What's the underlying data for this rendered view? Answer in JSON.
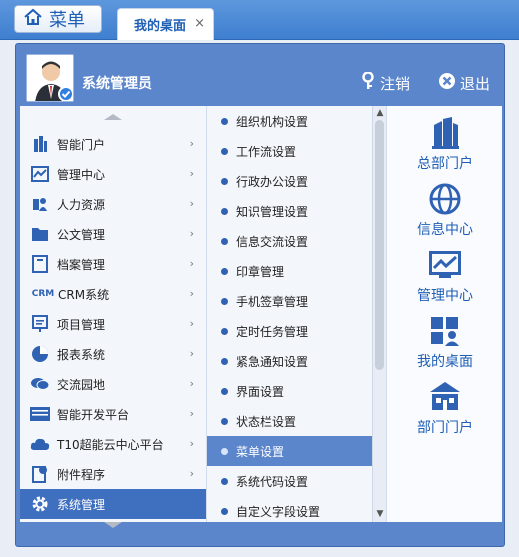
{
  "topbar": {
    "menu_label": "菜单",
    "tab_label": "我的桌面",
    "tab_close": "×"
  },
  "popup": {
    "username": "系统管理员",
    "logout_label": "注销",
    "exit_label": "退出",
    "level1": [
      {
        "label": "智能门户",
        "icon": "building-icon"
      },
      {
        "label": "管理中心",
        "icon": "chart-line-icon"
      },
      {
        "label": "人力资源",
        "icon": "hr-icon"
      },
      {
        "label": "公文管理",
        "icon": "folder-icon"
      },
      {
        "label": "档案管理",
        "icon": "archive-icon"
      },
      {
        "label": "CRM系统",
        "icon": "crm-icon",
        "icon_text": "CRM"
      },
      {
        "label": "项目管理",
        "icon": "project-board-icon"
      },
      {
        "label": "报表系统",
        "icon": "pie-chart-icon"
      },
      {
        "label": "交流园地",
        "icon": "chat-icon"
      },
      {
        "label": "智能开发平台",
        "icon": "dev-platform-icon"
      },
      {
        "label": "T10超能云中心平台",
        "icon": "cloud-icon"
      },
      {
        "label": "附件程序",
        "icon": "attachment-icon"
      },
      {
        "label": "系统管理",
        "icon": "gear-icon",
        "active": true
      }
    ],
    "level2": [
      {
        "label": "组织机构设置"
      },
      {
        "label": "工作流设置"
      },
      {
        "label": "行政办公设置"
      },
      {
        "label": "知识管理设置"
      },
      {
        "label": "信息交流设置"
      },
      {
        "label": "印章管理"
      },
      {
        "label": "手机签章管理"
      },
      {
        "label": "定时任务管理"
      },
      {
        "label": "紧急通知设置"
      },
      {
        "label": "界面设置"
      },
      {
        "label": "状态栏设置"
      },
      {
        "label": "菜单设置",
        "active": true
      },
      {
        "label": "系统代码设置"
      },
      {
        "label": "自定义字段设置"
      }
    ],
    "apps": [
      {
        "label": "总部门户",
        "icon": "headquarters-icon"
      },
      {
        "label": "信息中心",
        "icon": "globe-icon"
      },
      {
        "label": "管理中心",
        "icon": "monitor-chart-icon"
      },
      {
        "label": "我的桌面",
        "icon": "desktop-grid-icon"
      },
      {
        "label": "部门门户",
        "icon": "department-icon"
      }
    ]
  },
  "colors": {
    "primary": "#3f7fd0",
    "popup_bg": "#5b86cc",
    "active_item": "#3f6fbf",
    "icon_blue": "#2f62b3"
  }
}
